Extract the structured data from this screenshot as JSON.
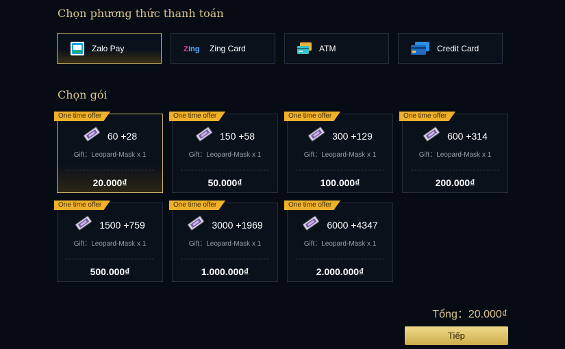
{
  "payment_section": {
    "title": "Chọn phương thức thanh toán",
    "methods": [
      {
        "label": "Zalo Pay",
        "icon": "zalopay-icon"
      },
      {
        "label": "Zing Card",
        "icon": "zing-card-icon"
      },
      {
        "label": "ATM",
        "icon": "atm-card-icon"
      },
      {
        "label": "Credit Card",
        "icon": "credit-card-icon"
      }
    ],
    "selected_index": 0
  },
  "package_section": {
    "title": "Chọn gói",
    "badge_label": "One time offer",
    "gift_label": "Gift：Leopard-Mask x 1",
    "packages": [
      {
        "amount": "60 +28",
        "price": "20.000₫"
      },
      {
        "amount": "150 +58",
        "price": "50.000₫"
      },
      {
        "amount": "300 +129",
        "price": "100.000₫"
      },
      {
        "amount": "600 +314",
        "price": "200.000₫"
      },
      {
        "amount": "1500 +759",
        "price": "500.000₫"
      },
      {
        "amount": "3000 +1969",
        "price": "1.000.000₫"
      },
      {
        "amount": "6000 +4347",
        "price": "2.000.000₫"
      }
    ],
    "selected_index": 0
  },
  "summary": {
    "total_text": "Tổng：20.000₫",
    "next_label": "Tiếp"
  },
  "colors": {
    "background": "#070c14",
    "accent_gold": "#cfb56a",
    "badge": "#f0b12a"
  }
}
